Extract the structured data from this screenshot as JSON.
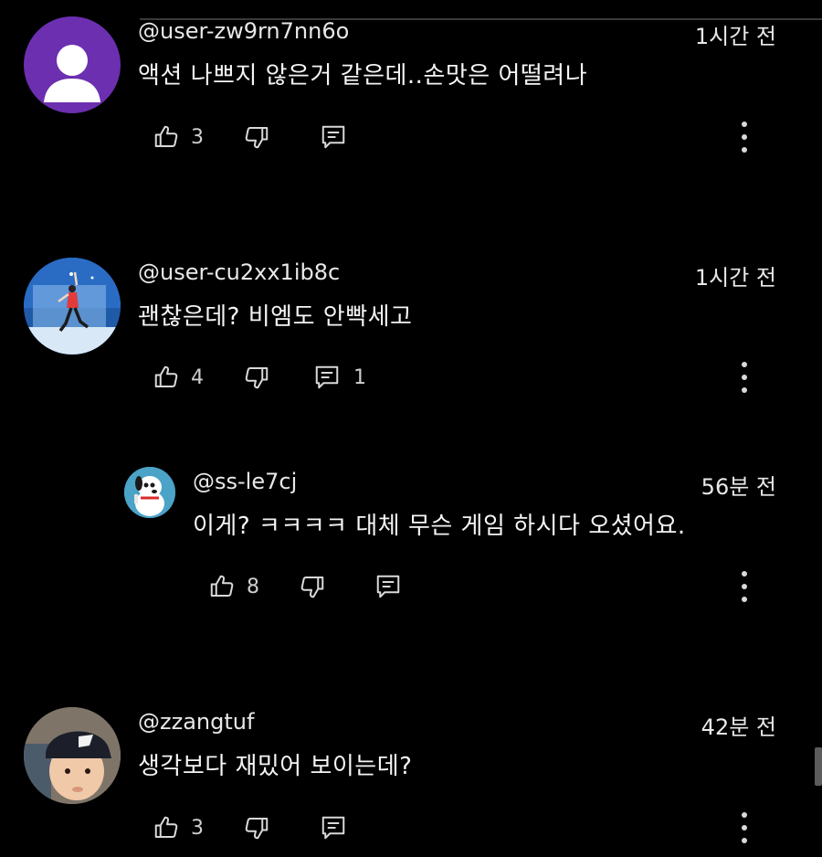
{
  "comments": [
    {
      "username": "@user-zw9rn7nn6o",
      "time": "1시간 전",
      "text": "액션 나쁘지 않은거 같은데..손맛은 어떨려나",
      "likes": "3",
      "replies": "",
      "avatar": "default-person-purple",
      "avatar_color": "#6b2fb0"
    },
    {
      "username": "@user-cu2xx1ib8c",
      "time": "1시간 전",
      "text": "괜찮은데? 비엠도 안빡세고",
      "likes": "4",
      "replies": "1",
      "avatar": "figure-skater"
    },
    {
      "username": "@ss-le7cj",
      "time": "56분 전",
      "text": "이게? ㅋㅋㅋㅋ 대체 무슨 게임 하시다 오셨어요.",
      "likes": "8",
      "replies": "",
      "avatar": "cartoon-dog",
      "is_reply": true
    },
    {
      "username": "@zzangtuf",
      "time": "42분 전",
      "text": "생각보다 재밌어 보이는데?",
      "likes": "3",
      "replies": "",
      "avatar": "baby-with-cap"
    }
  ],
  "icons": {
    "like": "thumbs-up-icon",
    "dislike": "thumbs-down-icon",
    "reply": "reply-comment-icon",
    "more": "more-vertical-icon"
  },
  "colors": {
    "background": "#000000",
    "text": "#f1f1f1",
    "secondary": "#cfcfcf"
  }
}
